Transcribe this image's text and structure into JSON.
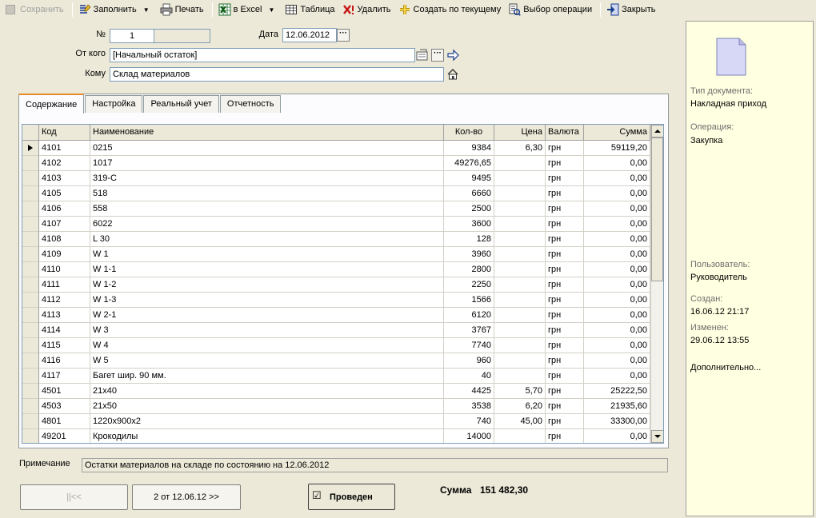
{
  "toolbar": {
    "save": "Сохранить",
    "fill": "Заполнить",
    "print": "Печать",
    "excel": "в Excel",
    "table": "Таблица",
    "delete": "Удалить",
    "create_from": "Создать по текущему",
    "choose_op": "Выбор операции",
    "close": "Закрыть"
  },
  "form": {
    "num_label": "№",
    "num_value": "1",
    "date_label": "Дата",
    "date_value": "12.06.2012",
    "from_label": "От кого",
    "from_value": "[Начальный остаток]",
    "to_label": "Кому",
    "to_value": "Склад материалов"
  },
  "tabs": [
    "Содержание",
    "Настройка",
    "Реальный учет",
    "Отчетность"
  ],
  "grid": {
    "headers": {
      "code": "Код",
      "name": "Наименование",
      "qty": "Кол-во",
      "price": "Цена",
      "currency": "Валюта",
      "sum": "Сумма"
    },
    "rows": [
      {
        "code": "4101",
        "name": "0215",
        "qty": "9384",
        "price": "6,30",
        "currency": "грн",
        "sum": "59119,20"
      },
      {
        "code": "4102",
        "name": "1017",
        "qty": "49276,65",
        "price": "",
        "currency": "грн",
        "sum": "0,00"
      },
      {
        "code": "4103",
        "name": "319-С",
        "qty": "9495",
        "price": "",
        "currency": "грн",
        "sum": "0,00"
      },
      {
        "code": "4105",
        "name": "518",
        "qty": "6660",
        "price": "",
        "currency": "грн",
        "sum": "0,00"
      },
      {
        "code": "4106",
        "name": "558",
        "qty": "2500",
        "price": "",
        "currency": "грн",
        "sum": "0,00"
      },
      {
        "code": "4107",
        "name": "6022",
        "qty": "3600",
        "price": "",
        "currency": "грн",
        "sum": "0,00"
      },
      {
        "code": "4108",
        "name": "L 30",
        "qty": "128",
        "price": "",
        "currency": "грн",
        "sum": "0,00"
      },
      {
        "code": "4109",
        "name": "W 1",
        "qty": "3960",
        "price": "",
        "currency": "грн",
        "sum": "0,00"
      },
      {
        "code": "4110",
        "name": "W 1-1",
        "qty": "2800",
        "price": "",
        "currency": "грн",
        "sum": "0,00"
      },
      {
        "code": "4111",
        "name": "W 1-2",
        "qty": "2250",
        "price": "",
        "currency": "грн",
        "sum": "0,00"
      },
      {
        "code": "4112",
        "name": "W 1-3",
        "qty": "1566",
        "price": "",
        "currency": "грн",
        "sum": "0,00"
      },
      {
        "code": "4113",
        "name": "W 2-1",
        "qty": "6120",
        "price": "",
        "currency": "грн",
        "sum": "0,00"
      },
      {
        "code": "4114",
        "name": "W 3",
        "qty": "3767",
        "price": "",
        "currency": "грн",
        "sum": "0,00"
      },
      {
        "code": "4115",
        "name": "W 4",
        "qty": "7740",
        "price": "",
        "currency": "грн",
        "sum": "0,00"
      },
      {
        "code": "4116",
        "name": "W 5",
        "qty": "960",
        "price": "",
        "currency": "грн",
        "sum": "0,00"
      },
      {
        "code": "4117",
        "name": "Багет шир. 90 мм.",
        "qty": "40",
        "price": "",
        "currency": "грн",
        "sum": "0,00"
      },
      {
        "code": "4501",
        "name": "21x40",
        "qty": "4425",
        "price": "5,70",
        "currency": "грн",
        "sum": "25222,50"
      },
      {
        "code": "4503",
        "name": "21x50",
        "qty": "3538",
        "price": "6,20",
        "currency": "грн",
        "sum": "21935,60"
      },
      {
        "code": "4801",
        "name": "1220x900x2",
        "qty": "740",
        "price": "45,00",
        "currency": "грн",
        "sum": "33300,00"
      },
      {
        "code": "49201",
        "name": "Крокодилы",
        "qty": "14000",
        "price": "",
        "currency": "грн",
        "sum": "0,00"
      }
    ]
  },
  "note": {
    "label": "Примечание",
    "value": "Остатки материалов на складе по состоянию на 12.06.2012"
  },
  "nav": {
    "first": "||<<",
    "next": "2 от 12.06.12 >>"
  },
  "posted": {
    "label": "Проведен",
    "checked": "☑"
  },
  "total": {
    "label": "Сумма",
    "value": "151 482,30"
  },
  "info": {
    "doc_type_label": "Тип документа:",
    "doc_type_value": "Накладная приход",
    "operation_label": "Операция:",
    "operation_value": "Закупка",
    "user_label": "Пользователь:",
    "user_value": "Руководитель",
    "created_label": "Создан:",
    "created_value": "16.06.12  21:17",
    "modified_label": "Изменен:",
    "modified_value": "29.06.12  13:55",
    "more": "Дополнительно..."
  }
}
